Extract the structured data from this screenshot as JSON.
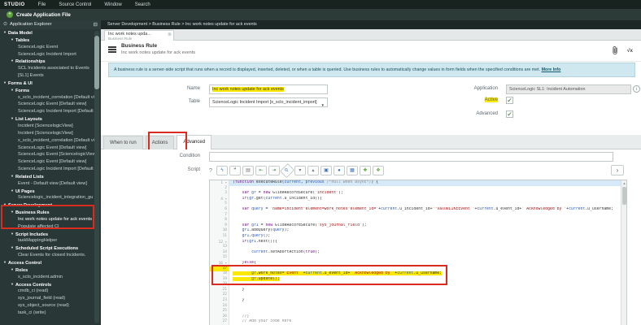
{
  "menu": {
    "brand": "STUDIO",
    "items": [
      "File",
      "Source Control",
      "Window",
      "Search"
    ]
  },
  "create_button_label": "Create Application File",
  "explorer": {
    "title": "Application Explorer"
  },
  "breadcrumb": "Server Development > Business Rule > Inc work notes update for ack events",
  "tab": {
    "title": "Inc work notes upda...",
    "subtitle": "Business Rule"
  },
  "doc": {
    "type_label": "Business Rule",
    "name": "Inc work notes update for ack events"
  },
  "banner": {
    "text": "A business rule is a server-side script that runs when a record is displayed, inserted, deleted, or when a table is queried. Use business rules to automatically change values in form fields when the specified conditions are met.",
    "link": "More Info"
  },
  "form": {
    "name": {
      "label": "Name",
      "value": "Inc work notes update for ack events"
    },
    "table": {
      "label": "Table",
      "value": "ScienceLogic Incident Import [x_sclo_incident_import]"
    },
    "application": {
      "label": "Application",
      "value": "ScienceLogic SL1: Incident Automation"
    },
    "active": {
      "label": "Active",
      "checked": true
    },
    "advanced": {
      "label": "Advanced",
      "checked": true
    }
  },
  "section_tabs": [
    {
      "label": "When to run",
      "active": false
    },
    {
      "label": "Actions",
      "active": false
    },
    {
      "label": "Advanced",
      "active": true
    }
  ],
  "condition": {
    "label": "Condition",
    "value": ""
  },
  "script_section": {
    "label": "Script",
    "toolbar": [
      {
        "name": "editor-toggle-icon",
        "glyph": "ϟ",
        "color": "#3b73b9"
      },
      {
        "name": "comment-icon",
        "glyph": "❞",
        "color": "#777777"
      },
      {
        "name": "format-code-icon",
        "glyph": "▤",
        "color": "#777777"
      },
      {
        "name": "outdent-icon",
        "glyph": "⇤",
        "color": "#5b8f5b"
      },
      {
        "name": "indent-icon",
        "glyph": "⇥",
        "color": "#5b8f5b"
      },
      {
        "name": "search-icon",
        "glyph": "⚲",
        "color": "#3b73b9"
      },
      {
        "name": "find-next-icon",
        "glyph": "▾",
        "color": "#777777"
      },
      {
        "name": "find-previous-icon",
        "glyph": "▴",
        "color": "#777777"
      },
      {
        "name": "open-window-icon",
        "glyph": "▣",
        "color": "#3b73b9"
      },
      {
        "name": "scope-icon",
        "glyph": "●",
        "color": "#3b73b9"
      },
      {
        "name": "save-icon",
        "glyph": "▦",
        "color": "#3b73b9"
      },
      {
        "name": "insert-code-icon",
        "glyph": "✚",
        "color": "#5aa13c"
      },
      {
        "name": "api-reference-icon",
        "glyph": "❖",
        "color": "#5aa13c"
      }
    ],
    "help_glyph": "?"
  },
  "sidebar": {
    "tree": [
      {
        "label": "Data Model",
        "level": 0,
        "branch": true
      },
      {
        "label": "Tables",
        "level": 1,
        "branch": true
      },
      {
        "label": "ScienceLogic Event",
        "level": 2
      },
      {
        "label": "ScienceLogic Incident Import",
        "level": 2
      },
      {
        "label": "Relationships",
        "level": 1,
        "branch": true
      },
      {
        "label": "SCL Incidents associated to Events",
        "level": 2
      },
      {
        "label": "[SL1] Events",
        "level": 2
      },
      {
        "label": "Forms & UI",
        "level": 0,
        "branch": true
      },
      {
        "label": "Forms",
        "level": 1,
        "branch": true
      },
      {
        "label": "x_sclo_incident_correlation [Default vi",
        "level": 2
      },
      {
        "label": "ScienceLogic Event [Default view]",
        "level": 2
      },
      {
        "label": "ScienceLogic Incident Import [Default v",
        "level": 2
      },
      {
        "label": "List Layouts",
        "level": 1,
        "branch": true
      },
      {
        "label": "Incident [SciencelogicView]",
        "level": 2
      },
      {
        "label": "Incident [SciencelogicView]",
        "level": 2
      },
      {
        "label": "x_sclo_incident_correlation [Default vi",
        "level": 2
      },
      {
        "label": "ScienceLogic Event [Default view]",
        "level": 2
      },
      {
        "label": "ScienceLogic Event [SciencelogicView]",
        "level": 2
      },
      {
        "label": "ScienceLogic Event [Default view]",
        "level": 2
      },
      {
        "label": "ScienceLogic Incident Import [Default v",
        "level": 2
      },
      {
        "label": "Related Lists",
        "level": 1,
        "branch": true
      },
      {
        "label": "Event - Default view [Default view]",
        "level": 2
      },
      {
        "label": "UI Pages",
        "level": 1,
        "branch": true
      },
      {
        "label": "Sciencelogic_incident_integration_gu",
        "level": 2
      },
      {
        "label": "Server Development",
        "level": 0,
        "branch": true
      },
      {
        "label": "Business Rules",
        "level": 1,
        "branch": true
      },
      {
        "label": "Inc work notes update for ack events",
        "level": 2,
        "selected": true
      },
      {
        "label": "Populate affected CI",
        "level": 2
      },
      {
        "label": "Script Includes",
        "level": 1,
        "branch": true
      },
      {
        "label": "taskMappingHelper",
        "level": 2
      },
      {
        "label": "Scheduled Script Executions",
        "level": 1,
        "branch": true
      },
      {
        "label": "Clear Events for closed Incidents.",
        "level": 2
      },
      {
        "label": "Access Control",
        "level": 0,
        "branch": true
      },
      {
        "label": "Roles",
        "level": 1,
        "branch": true
      },
      {
        "label": "x_sclo_incident.admin",
        "level": 2
      },
      {
        "label": "Access Controls",
        "level": 1,
        "branch": true
      },
      {
        "label": "cmdb_ci (read)",
        "level": 2
      },
      {
        "label": "sys_journal_field (read)",
        "level": 2
      },
      {
        "label": "sys_object_source (read)",
        "level": 2
      },
      {
        "label": "task_ci (write)",
        "level": 2
      }
    ]
  },
  "code": {
    "lines": [
      {
        "n": 1,
        "text": "(function executeRule(current, previous /*null when async*/) {",
        "fold": true,
        "hl": "blue"
      },
      {
        "n": 2,
        "text": ""
      },
      {
        "n": 3,
        "text": "    var gr = new GlideRecordSecure('incident');"
      },
      {
        "n": 4,
        "text": "    if(gr.get(current.u_incident_id)){",
        "fold": true
      },
      {
        "n": 5,
        "text": ""
      },
      {
        "n": 6,
        "text": "    var query = 'name=incident^element=work_notes^element_id='+current.u_incident_id+'^valueLIKEEvent '+current.u_event_id+' Acknowledged by '+current.u_username;"
      },
      {
        "n": 7,
        "text": ""
      },
      {
        "n": 8,
        "text": ""
      },
      {
        "n": 9,
        "text": "    var gr1 = new GlideRecordSecure('sys_journal_field');"
      },
      {
        "n": 10,
        "text": "    gr1.addQuery(query);"
      },
      {
        "n": 11,
        "text": "    gr1.query();"
      },
      {
        "n": 12,
        "text": "    if(gr1.next()){",
        "fold": true
      },
      {
        "n": 13,
        "text": ""
      },
      {
        "n": 14,
        "text": "        current.setAbortAction(true);"
      },
      {
        "n": 15,
        "text": ""
      },
      {
        "n": 16,
        "text": "    }else{",
        "fold": true
      },
      {
        "n": 17,
        "text": "",
        "hl": "gutter-yellow"
      },
      {
        "n": 18,
        "text": "        gr.work_notes='Event '+current.u_event_id+' Acknowledged by '+current.u_username;",
        "hl": "yellow"
      },
      {
        "n": 19,
        "text": "        gr.update();",
        "hl": "yellow"
      },
      {
        "n": 20,
        "text": ""
      },
      {
        "n": 21,
        "text": "    }"
      },
      {
        "n": 22,
        "text": ""
      },
      {
        "n": 23,
        "text": "    }"
      },
      {
        "n": 24,
        "text": ""
      },
      {
        "n": 25,
        "text": ""
      },
      {
        "n": 26,
        "text": "    //}"
      },
      {
        "n": 27,
        "text": "    // Add your code here"
      }
    ]
  }
}
